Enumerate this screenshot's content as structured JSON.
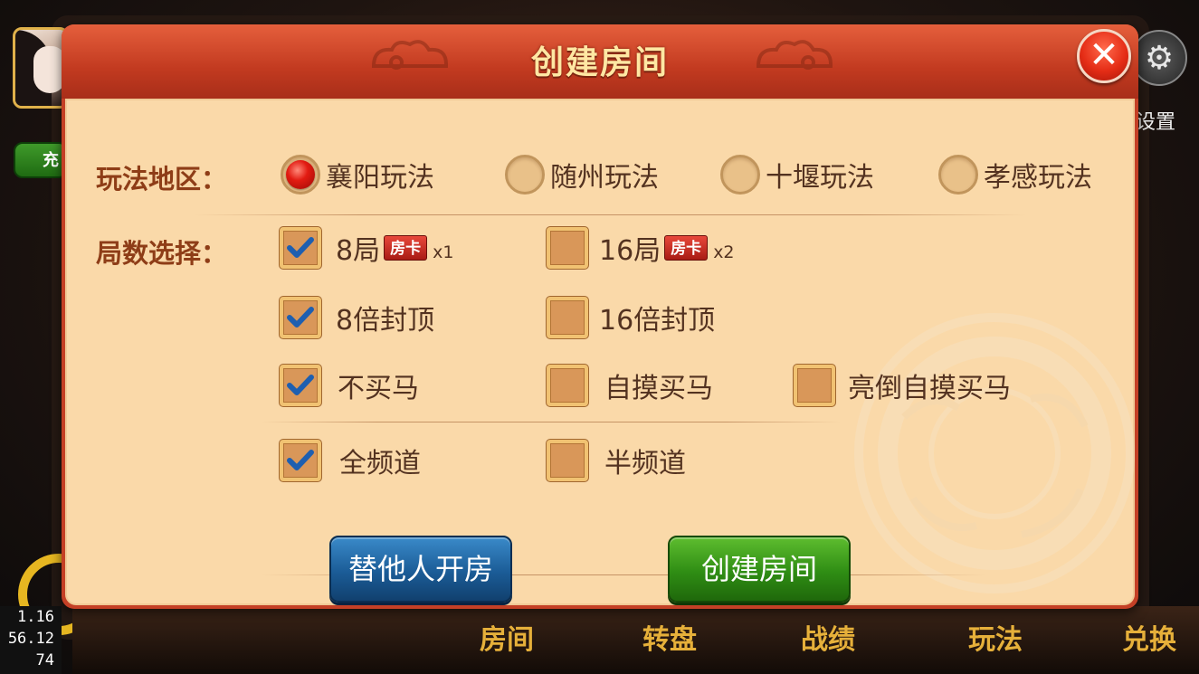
{
  "window": {
    "title": "创建房间",
    "close_icon": "close-icon"
  },
  "background": {
    "settings_label": "设置",
    "recharge_label": "充",
    "nav": [
      "房间",
      "转盘",
      "战绩",
      "玩法",
      "兑换"
    ],
    "stats": [
      "1.16",
      "56.12",
      "74"
    ]
  },
  "region": {
    "label": "玩法地区：",
    "options": [
      {
        "label": "襄阳玩法",
        "selected": true
      },
      {
        "label": "随州玩法",
        "selected": false
      },
      {
        "label": "十堰玩法",
        "selected": false
      },
      {
        "label": "孝感玩法",
        "selected": false
      }
    ]
  },
  "rounds": {
    "label": "局数选择：",
    "options": [
      {
        "label": "8局",
        "badge": "房卡",
        "multiplier": "x1",
        "checked": true
      },
      {
        "label": "16局",
        "badge": "房卡",
        "multiplier": "x2",
        "checked": false
      }
    ]
  },
  "cap": {
    "options": [
      {
        "label": "8倍封顶",
        "checked": true
      },
      {
        "label": "16倍封顶",
        "checked": false
      }
    ]
  },
  "horse": {
    "options": [
      {
        "label": "不买马",
        "checked": true
      },
      {
        "label": "自摸买马",
        "checked": false
      },
      {
        "label": "亮倒自摸买马",
        "checked": false
      }
    ]
  },
  "channel": {
    "options": [
      {
        "label": "全频道",
        "checked": true
      },
      {
        "label": "半频道",
        "checked": false
      }
    ]
  },
  "buttons": {
    "open_for_others": "替他人开房",
    "create_room": "创建房间"
  },
  "colors": {
    "header": "#c44026",
    "panel": "#fad9a9",
    "label": "#8e3d17",
    "blue_button": "#1b5c97",
    "green_button": "#2f8d14"
  }
}
